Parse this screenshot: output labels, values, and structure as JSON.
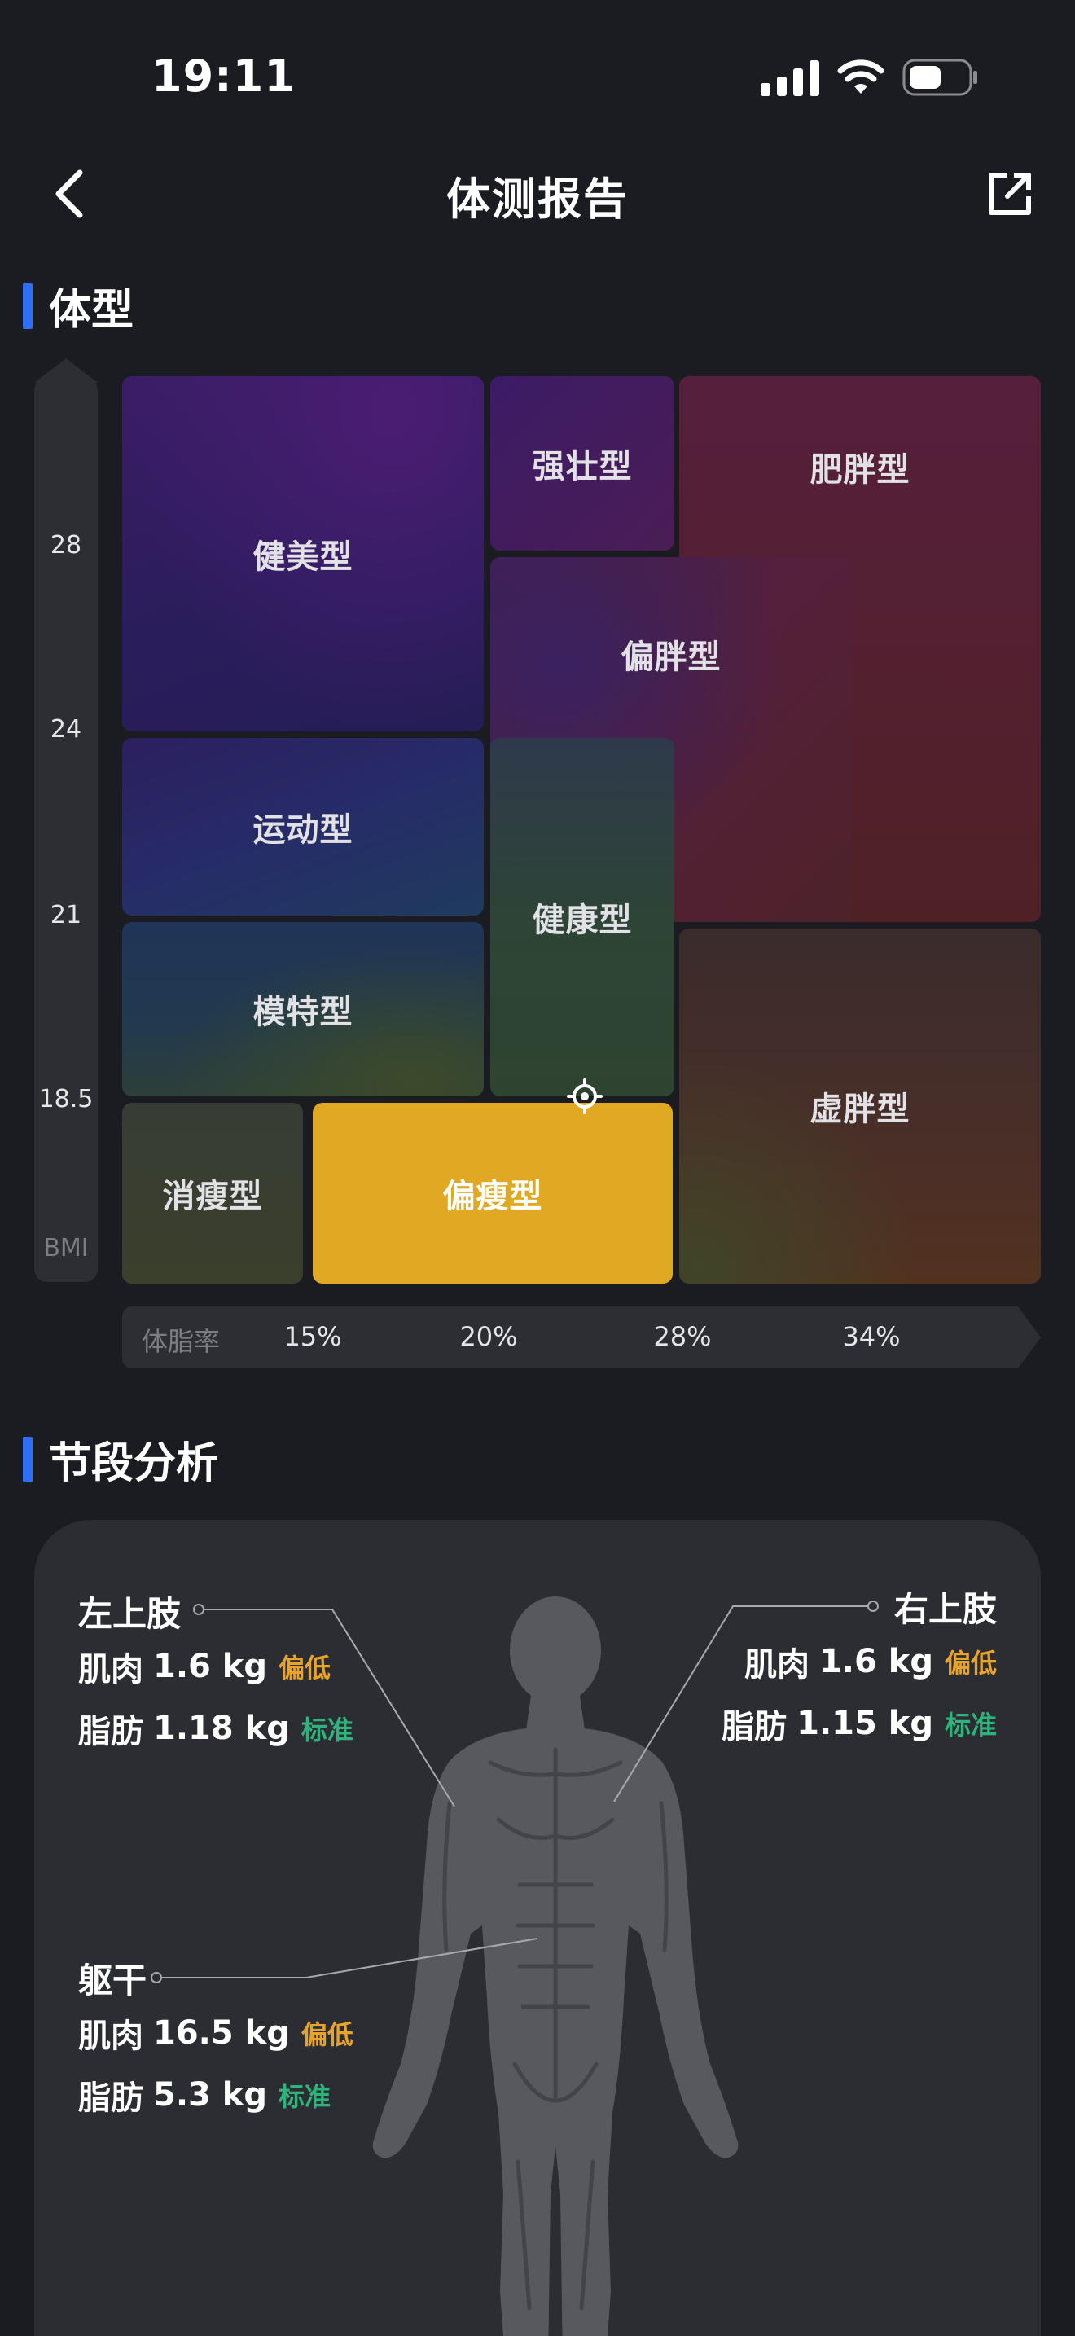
{
  "status_bar": {
    "time": "19:11"
  },
  "nav": {
    "title": "体测报告"
  },
  "body_type": {
    "section_title": "体型",
    "bmi_axis": {
      "label": "BMI",
      "ticks": [
        "28",
        "24",
        "21",
        "18.5"
      ]
    },
    "cells": {
      "jianmei": "健美型",
      "qiangzhuang": "强壮型",
      "feipang": "肥胖型",
      "pianpang": "偏胖型",
      "yundong": "运动型",
      "jiankang": "健康型",
      "mote": "模特型",
      "xupang": "虚胖型",
      "xiaoshou": "消瘦型",
      "pianshou": "偏瘦型"
    },
    "selected": "偏瘦型",
    "colors": {
      "selected": "#e1a822",
      "accent": "#2f6ef6"
    },
    "fat_axis": {
      "label": "体脂率",
      "ticks": [
        "15%",
        "20%",
        "28%",
        "34%"
      ]
    }
  },
  "segment": {
    "section_title": "节段分析",
    "left_arm": {
      "name": "左上肢",
      "muscle_label": "肌肉",
      "muscle_value": "1.6 kg",
      "muscle_status": "偏低",
      "fat_label": "脂肪",
      "fat_value": "1.18 kg",
      "fat_status": "标准"
    },
    "right_arm": {
      "name": "右上肢",
      "muscle_label": "肌肉",
      "muscle_value": "1.6 kg",
      "muscle_status": "偏低",
      "fat_label": "脂肪",
      "fat_value": "1.15 kg",
      "fat_status": "标准"
    },
    "trunk": {
      "name": "躯干",
      "muscle_label": "肌肉",
      "muscle_value": "16.5 kg",
      "muscle_status": "偏低",
      "fat_label": "脂肪",
      "fat_value": "5.3 kg",
      "fat_status": "标准"
    },
    "colors": {
      "low": "#e6a42b",
      "standard": "#2fb27c"
    }
  }
}
